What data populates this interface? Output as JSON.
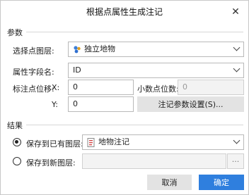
{
  "window": {
    "title": "根据点属性生成注记"
  },
  "params": {
    "section_title": "参数",
    "select_layer_label": "选择点图层:",
    "select_layer_value": "独立地物",
    "attr_field_label": "属性字段名:",
    "attr_field_value": "ID",
    "offset_label": "标注点位移:",
    "x_label": "X:",
    "x_value": "0",
    "decimal_label": "小数点位数:",
    "decimal_value": "0",
    "y_label": "Y:",
    "y_value": "0",
    "settings_button": "注记参数设置(S)..."
  },
  "result": {
    "section_title": "结果",
    "save_existing_label": "保存到已有图层:",
    "save_existing_value": "地物注记",
    "save_existing_checked": true,
    "save_new_label": "保存到新图层:",
    "save_new_value": "",
    "browse_label": "···"
  },
  "footer": {
    "cancel": "取消",
    "ok": "确定"
  },
  "colors": {
    "accent": "#2f7fde",
    "button_gray": "#e3e3e3"
  },
  "icons": {
    "close": "close-icon",
    "layer": "point-layer-icon",
    "annotation": "annotation-layer-icon",
    "dropdown": "chevron-down-icon"
  }
}
